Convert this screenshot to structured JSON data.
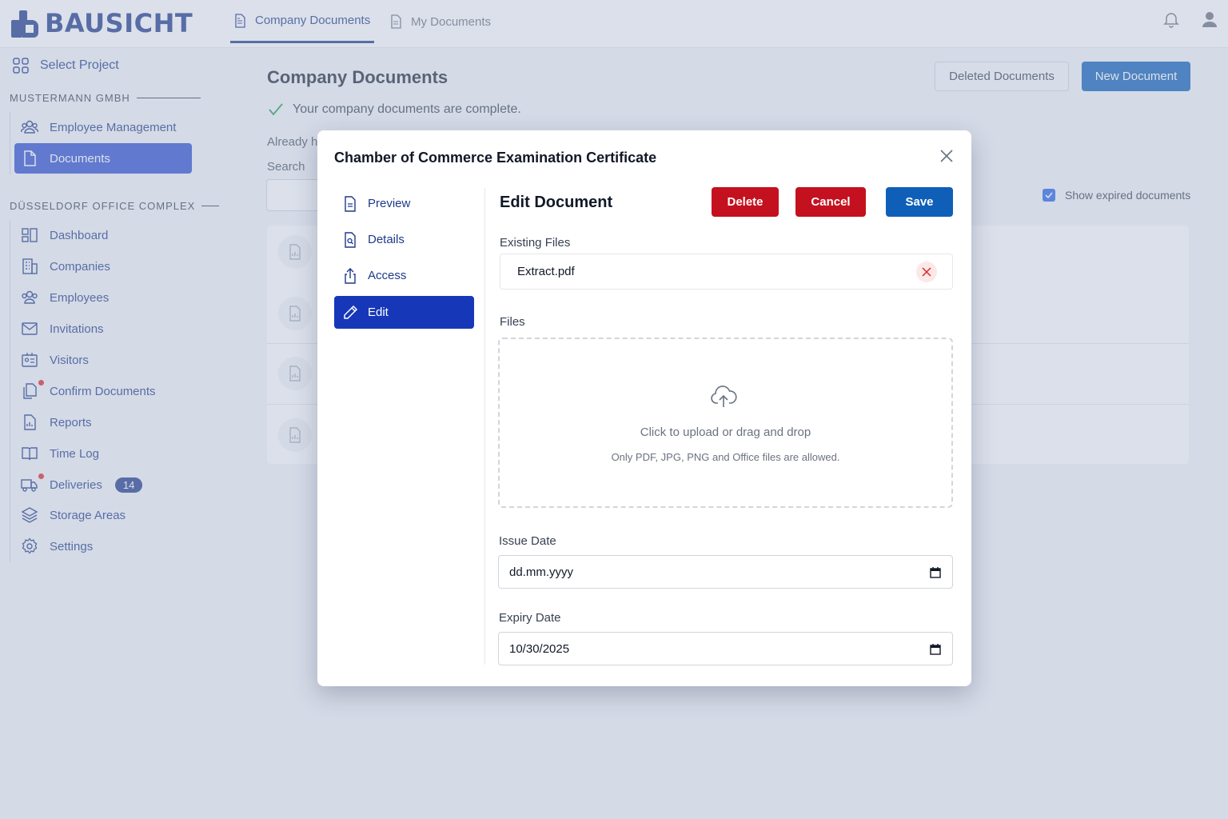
{
  "brand": {
    "name": "BAUSICHT"
  },
  "header": {
    "tabs": [
      {
        "label": "Company Documents",
        "icon": "document-icon",
        "active": true
      },
      {
        "label": "My Documents",
        "icon": "document-icon",
        "active": false
      }
    ]
  },
  "sidebar": {
    "select_project": "Select Project",
    "company_section": "MUSTERMANN GMBH",
    "company_items": [
      {
        "label": "Employee Management",
        "icon": "users-icon"
      },
      {
        "label": "Documents",
        "icon": "document-icon",
        "active": true
      }
    ],
    "site_section": "DÜSSELDORF OFFICE COMPLEX",
    "site_items": [
      {
        "label": "Dashboard",
        "icon": "dashboard-icon"
      },
      {
        "label": "Companies",
        "icon": "building-icon"
      },
      {
        "label": "Employees",
        "icon": "users-icon"
      },
      {
        "label": "Invitations",
        "icon": "mail-icon"
      },
      {
        "label": "Visitors",
        "icon": "id-card-icon"
      },
      {
        "label": "Confirm Documents",
        "icon": "documents-icon",
        "notification": true
      },
      {
        "label": "Reports",
        "icon": "report-icon"
      },
      {
        "label": "Time Log",
        "icon": "book-icon"
      },
      {
        "label": "Deliveries",
        "icon": "truck-icon",
        "notification": true,
        "badge": "14"
      },
      {
        "label": "Storage Areas",
        "icon": "layers-icon"
      },
      {
        "label": "Settings",
        "icon": "gear-icon"
      }
    ]
  },
  "main": {
    "title": "Company Documents",
    "complete_message": "Your company documents are complete.",
    "already_text": "Already h",
    "search_label": "Search",
    "deleted_button": "Deleted Documents",
    "new_button": "New Document",
    "show_expired_label": "Show expired documents",
    "show_expired_checked": true
  },
  "modal": {
    "title": "Chamber of Commerce Examination Certificate",
    "nav": [
      {
        "label": "Preview",
        "icon": "document-icon"
      },
      {
        "label": "Details",
        "icon": "document-search-icon"
      },
      {
        "label": "Access",
        "icon": "share-icon"
      },
      {
        "label": "Edit",
        "icon": "pencil-icon",
        "active": true
      }
    ],
    "edit_title": "Edit Document",
    "delete_button": "Delete",
    "cancel_button": "Cancel",
    "save_button": "Save",
    "existing_files_label": "Existing Files",
    "existing_file": "Extract.pdf",
    "files_label": "Files",
    "upload_text": "Click to upload or drag and drop",
    "upload_hint": "Only PDF, JPG, PNG and Office files are allowed.",
    "issue_date_label": "Issue Date",
    "issue_date_value": "dd.mm.yyyy",
    "expiry_date_label": "Expiry Date",
    "expiry_date_value": "10/30/2025"
  },
  "colors": {
    "brand": "#1e3a8a",
    "primary": "#0f5fb8",
    "danger": "#c4111f",
    "active_nav": "#1638b8"
  }
}
